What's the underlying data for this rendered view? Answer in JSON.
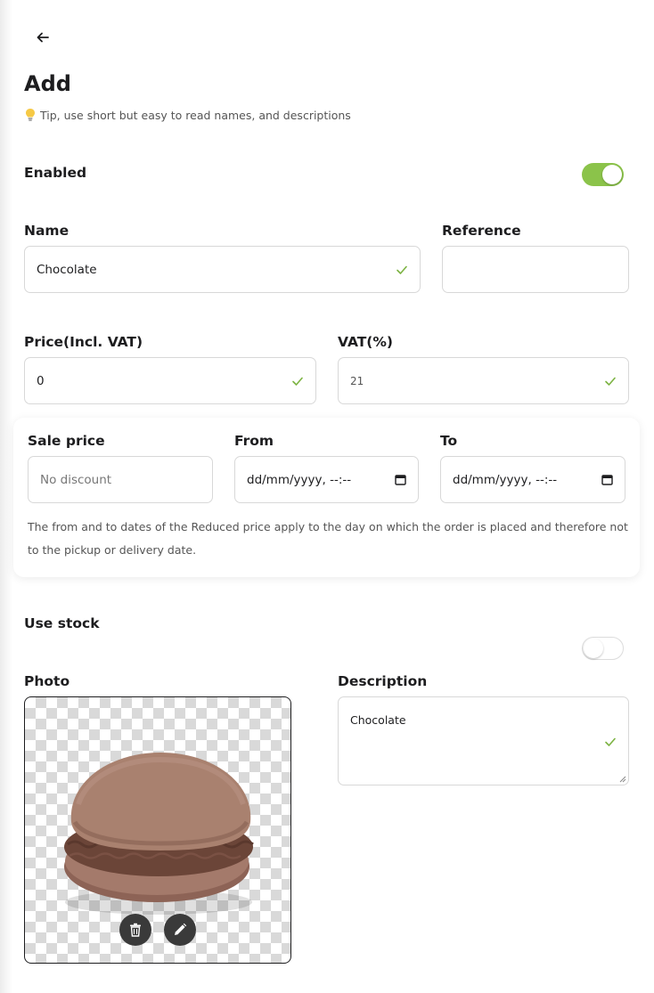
{
  "header": {
    "back_icon": "arrow-left-icon",
    "title": "Add",
    "tip_icon": "lightbulb-icon",
    "tip": "Tip, use short but easy to read names, and descriptions"
  },
  "enabled": {
    "label": "Enabled",
    "on": true
  },
  "name": {
    "label": "Name",
    "value": "Chocolate",
    "valid": true
  },
  "reference": {
    "label": "Reference",
    "value": ""
  },
  "price": {
    "label": "Price(Incl. VAT)",
    "value": "0",
    "valid": true
  },
  "vat": {
    "label": "VAT(%)",
    "value": "21",
    "valid": true
  },
  "sale": {
    "price_label": "Sale price",
    "price_placeholder": "No discount",
    "from_label": "From",
    "from_placeholder": "dd/mm/yyyy, --:--",
    "to_label": "To",
    "to_placeholder": "dd/mm/yyyy, --:--",
    "note": "The from and to dates of the Reduced price apply to the day on which the order is placed and therefore not to the pickup or delivery date."
  },
  "stock": {
    "label": "Use stock",
    "on": false
  },
  "photo": {
    "label": "Photo",
    "delete_icon": "trash-icon",
    "edit_icon": "pencil-icon"
  },
  "description": {
    "label": "Description",
    "value": "Chocolate",
    "valid": true
  },
  "colors": {
    "accent": "#8bc34a",
    "check": "#7cb342",
    "text": "#1d1d1f"
  }
}
